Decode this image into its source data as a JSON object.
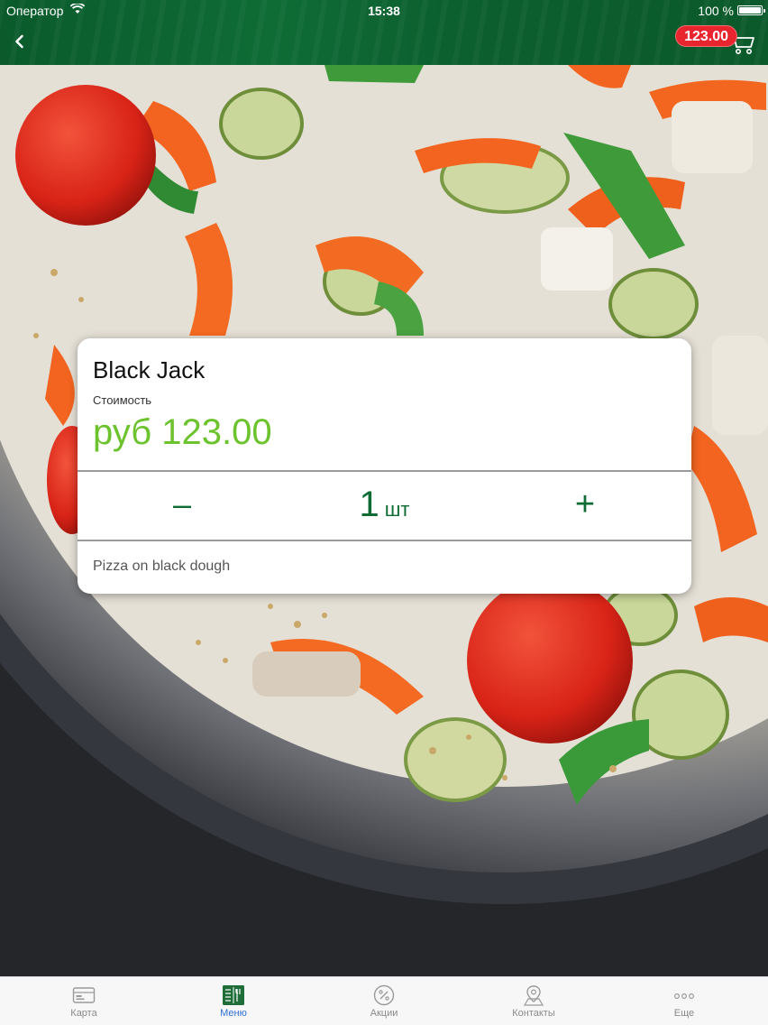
{
  "status_bar": {
    "carrier": "Оператор",
    "time": "15:38",
    "battery": "100 %"
  },
  "header": {
    "cart_total": "123.00"
  },
  "product": {
    "name": "Black Jack",
    "price_caption": "Стоимость",
    "price": "руб 123.00",
    "quantity": "1",
    "quantity_unit": "шт",
    "minus_label": "–",
    "plus_label": "+",
    "description": "Pizza on black dough"
  },
  "tabs": [
    {
      "label": "Карта",
      "icon": "card-icon",
      "active": false
    },
    {
      "label": "Меню",
      "icon": "menu-icon",
      "active": true
    },
    {
      "label": "Акции",
      "icon": "percent-icon",
      "active": false
    },
    {
      "label": "Контакты",
      "icon": "map-pin-icon",
      "active": false
    },
    {
      "label": "Еще",
      "icon": "more-icon",
      "active": false
    }
  ],
  "colors": {
    "header_green": "#0f6c35",
    "price_green": "#6cc32d",
    "quantity_green": "#0e6b33",
    "badge_red": "#e8242e",
    "tab_active": "#2f6fd6"
  }
}
